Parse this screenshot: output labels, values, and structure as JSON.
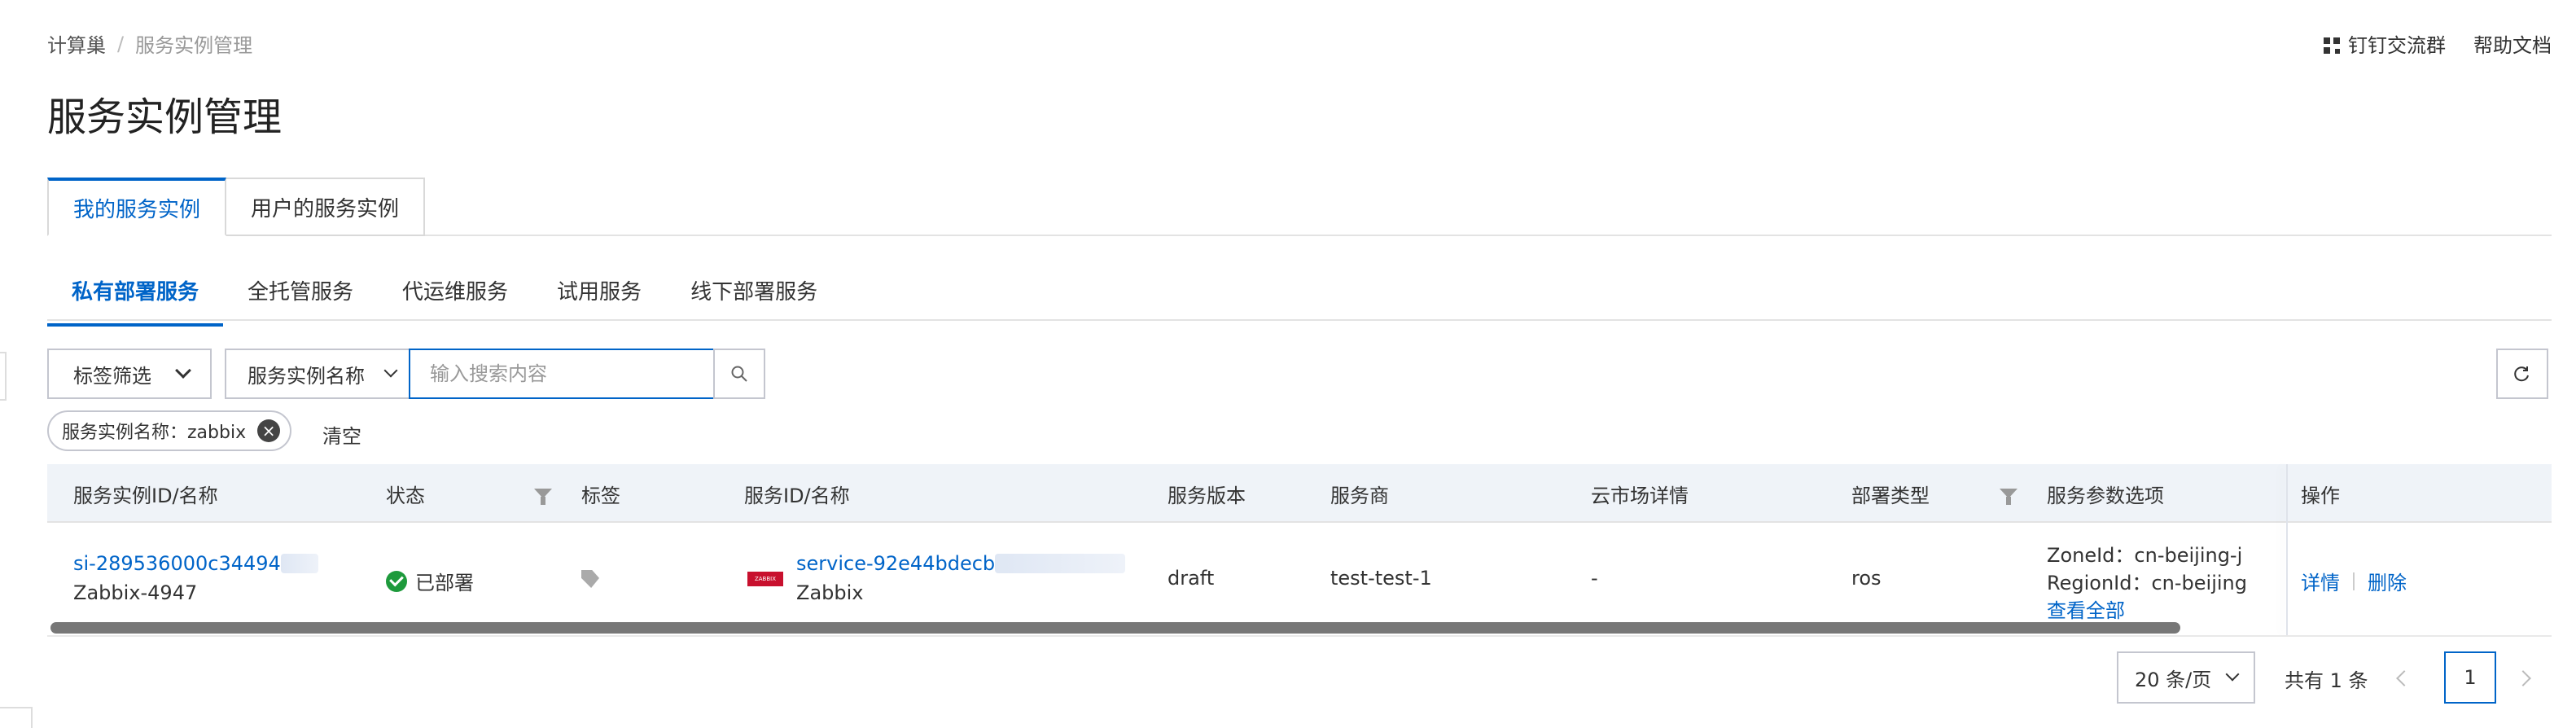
{
  "breadcrumb": {
    "root": "计算巢",
    "separator": "/",
    "current": "服务实例管理"
  },
  "header_links": {
    "dingtalk": "钉钉交流群",
    "help": "帮助文档"
  },
  "page_title": "服务实例管理",
  "main_tabs": [
    {
      "label": "我的服务实例",
      "active": true
    },
    {
      "label": "用户的服务实例",
      "active": false
    }
  ],
  "sub_tabs": [
    {
      "label": "私有部署服务",
      "active": true
    },
    {
      "label": "全托管服务",
      "active": false
    },
    {
      "label": "代运维服务",
      "active": false
    },
    {
      "label": "试用服务",
      "active": false
    },
    {
      "label": "线下部署服务",
      "active": false
    }
  ],
  "toolbar": {
    "tag_filter": "标签筛选",
    "search_field": "服务实例名称",
    "search_placeholder": "输入搜索内容",
    "search_icon": "search-icon",
    "refresh_icon": "refresh-icon"
  },
  "filter_chip": {
    "label": "服务实例名称：zabbix",
    "clear": "清空"
  },
  "table": {
    "columns": {
      "instance": "服务实例ID/名称",
      "status": "状态",
      "tags": "标签",
      "service": "服务ID/名称",
      "version": "服务版本",
      "provider": "服务商",
      "market": "云市场详情",
      "deploy_type": "部署类型",
      "params": "服务参数选项",
      "actions": "操作"
    },
    "rows": [
      {
        "instance_id": "si-289536000c34494",
        "instance_name": "Zabbix-4947",
        "status": "已部署",
        "status_color": "#1e9a3c",
        "service_logo_text": "ZABBIX",
        "service_id": "service-92e44bdecb",
        "service_name": "Zabbix",
        "version": "draft",
        "provider": "test-test-1",
        "market": "-",
        "deploy_type": "ros",
        "param_zone": "ZoneId：cn-beijing-j",
        "param_region": "RegionId：cn-beijing",
        "view_all": "查看全部",
        "detail": "详情",
        "delete": "删除"
      }
    ]
  },
  "pagination": {
    "page_size": "20 条/页",
    "total": "共有 1 条",
    "current_page": "1"
  },
  "colors": {
    "accent": "#0064c8",
    "header_bg": "#eff3f8"
  }
}
